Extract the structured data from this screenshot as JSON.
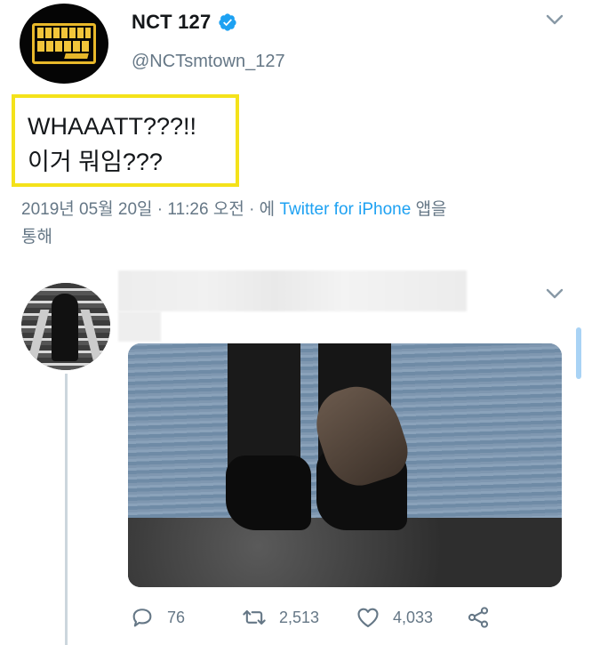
{
  "tweet": {
    "display_name": "NCT 127",
    "handle": "@NCTsmtown_127",
    "text_lines": [
      "WHAAATT???!!",
      "이거 뭐임???"
    ],
    "date": "2019년 05월 20일 · 11:26 오전 · 에",
    "source": "Twitter for iPhone",
    "source_suffix_line1": "앱을",
    "source_suffix_line2": "통해"
  },
  "reply": {
    "stats": {
      "replies": "76",
      "retweets": "2,513",
      "likes": "4,033"
    }
  },
  "icons": {
    "verified": "verified-badge-icon",
    "caret": "chevron-down-icon",
    "reply": "reply-bubble-icon",
    "retweet": "retweet-icon",
    "like": "heart-icon",
    "share": "share-icon"
  },
  "colors": {
    "accent": "#1da1f2",
    "muted": "#657786",
    "highlight_border": "#f4e21a"
  }
}
